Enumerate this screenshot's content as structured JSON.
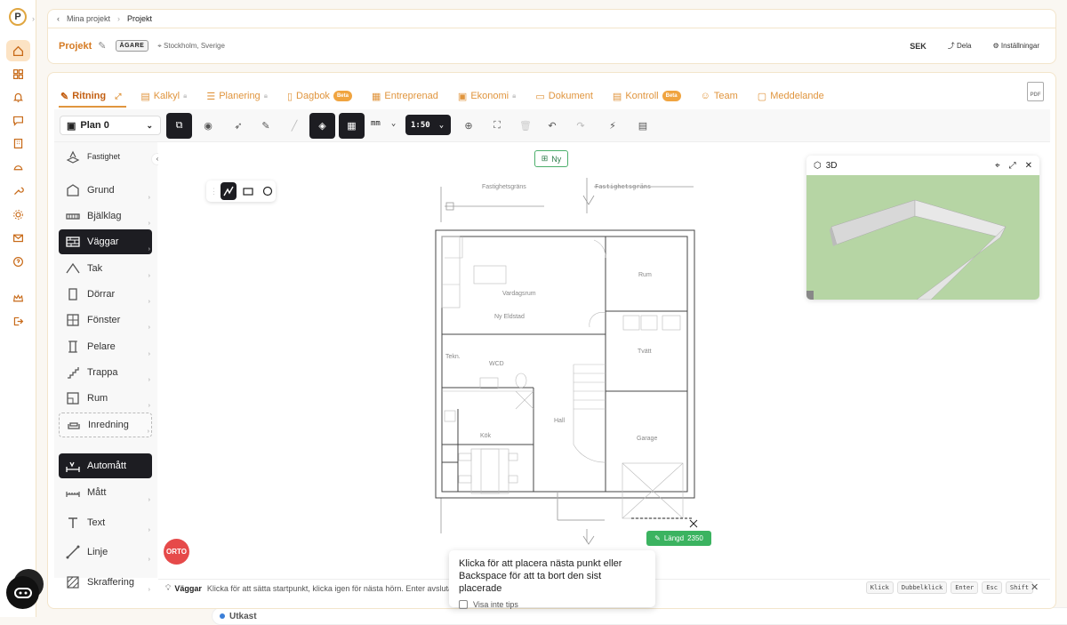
{
  "breadcrumb": {
    "items": [
      "Mina projekt",
      "Projekt"
    ]
  },
  "header": {
    "project_name": "Projekt",
    "owner_badge": "ÄGARE",
    "status": "Utkast",
    "location": "Stockholm, Sverige",
    "currency": "SEK",
    "share": "Dela",
    "settings": "Inställningar"
  },
  "tabs": [
    {
      "label": "Ritning",
      "active": true
    },
    {
      "label": "Kalkyl",
      "locked": true
    },
    {
      "label": "Planering",
      "locked": true
    },
    {
      "label": "Dagbok",
      "badge": "Beta"
    },
    {
      "label": "Entreprenad"
    },
    {
      "label": "Ekonomi",
      "locked": true
    },
    {
      "label": "Dokument"
    },
    {
      "label": "Kontroll",
      "badge": "Beta"
    },
    {
      "label": "Team"
    },
    {
      "label": "Meddelande"
    }
  ],
  "pdf_label": "PDF",
  "toolbar": {
    "plan": "Plan 0",
    "unit": "mm",
    "scale": "1:50"
  },
  "sidebar": {
    "property": "Fastighet",
    "items": [
      "Grund",
      "Bjälklag",
      "Väggar",
      "Tak",
      "Dörrar",
      "Fönster",
      "Pelare",
      "Trappa",
      "Rum",
      "Inredning",
      "Automått",
      "Mått",
      "Text",
      "Linje",
      "Skraffering"
    ],
    "active": "Väggar"
  },
  "canvas": {
    "new_button": "Ny",
    "boundary_labels": [
      "Fastighetsgräns",
      "Fastighetsgräns"
    ],
    "room_labels": [
      "Vardagsrum",
      "Ny Eldstad",
      "Rum",
      "Tvätt",
      "Tekn.",
      "WCD",
      "Hall",
      "Kök",
      "Garage"
    ],
    "length_label": "Längd",
    "length_value": "2350",
    "orto": "ORTO"
  },
  "panel3d": {
    "title": "3D"
  },
  "statusbar": {
    "mode": "Väggar",
    "hint": "Klicka för att sätta startpunkt, klicka igen för nästa hörn. Enter avslutar. I grund/bjälklag: auto-vägg längs kontur.",
    "keys": [
      "Klick",
      "Dubbelklick",
      "Enter",
      "Esc",
      "Shift"
    ]
  },
  "tip": {
    "line1": "Klicka för att placera nästa punkt eller",
    "line2": "Backspace för att ta bort den sist placerade",
    "checkbox": "Visa inte tips"
  },
  "colors": {
    "accent": "#e0963e",
    "dark": "#1d1d22",
    "green": "#3bb360",
    "orto": "#e64a4a"
  }
}
